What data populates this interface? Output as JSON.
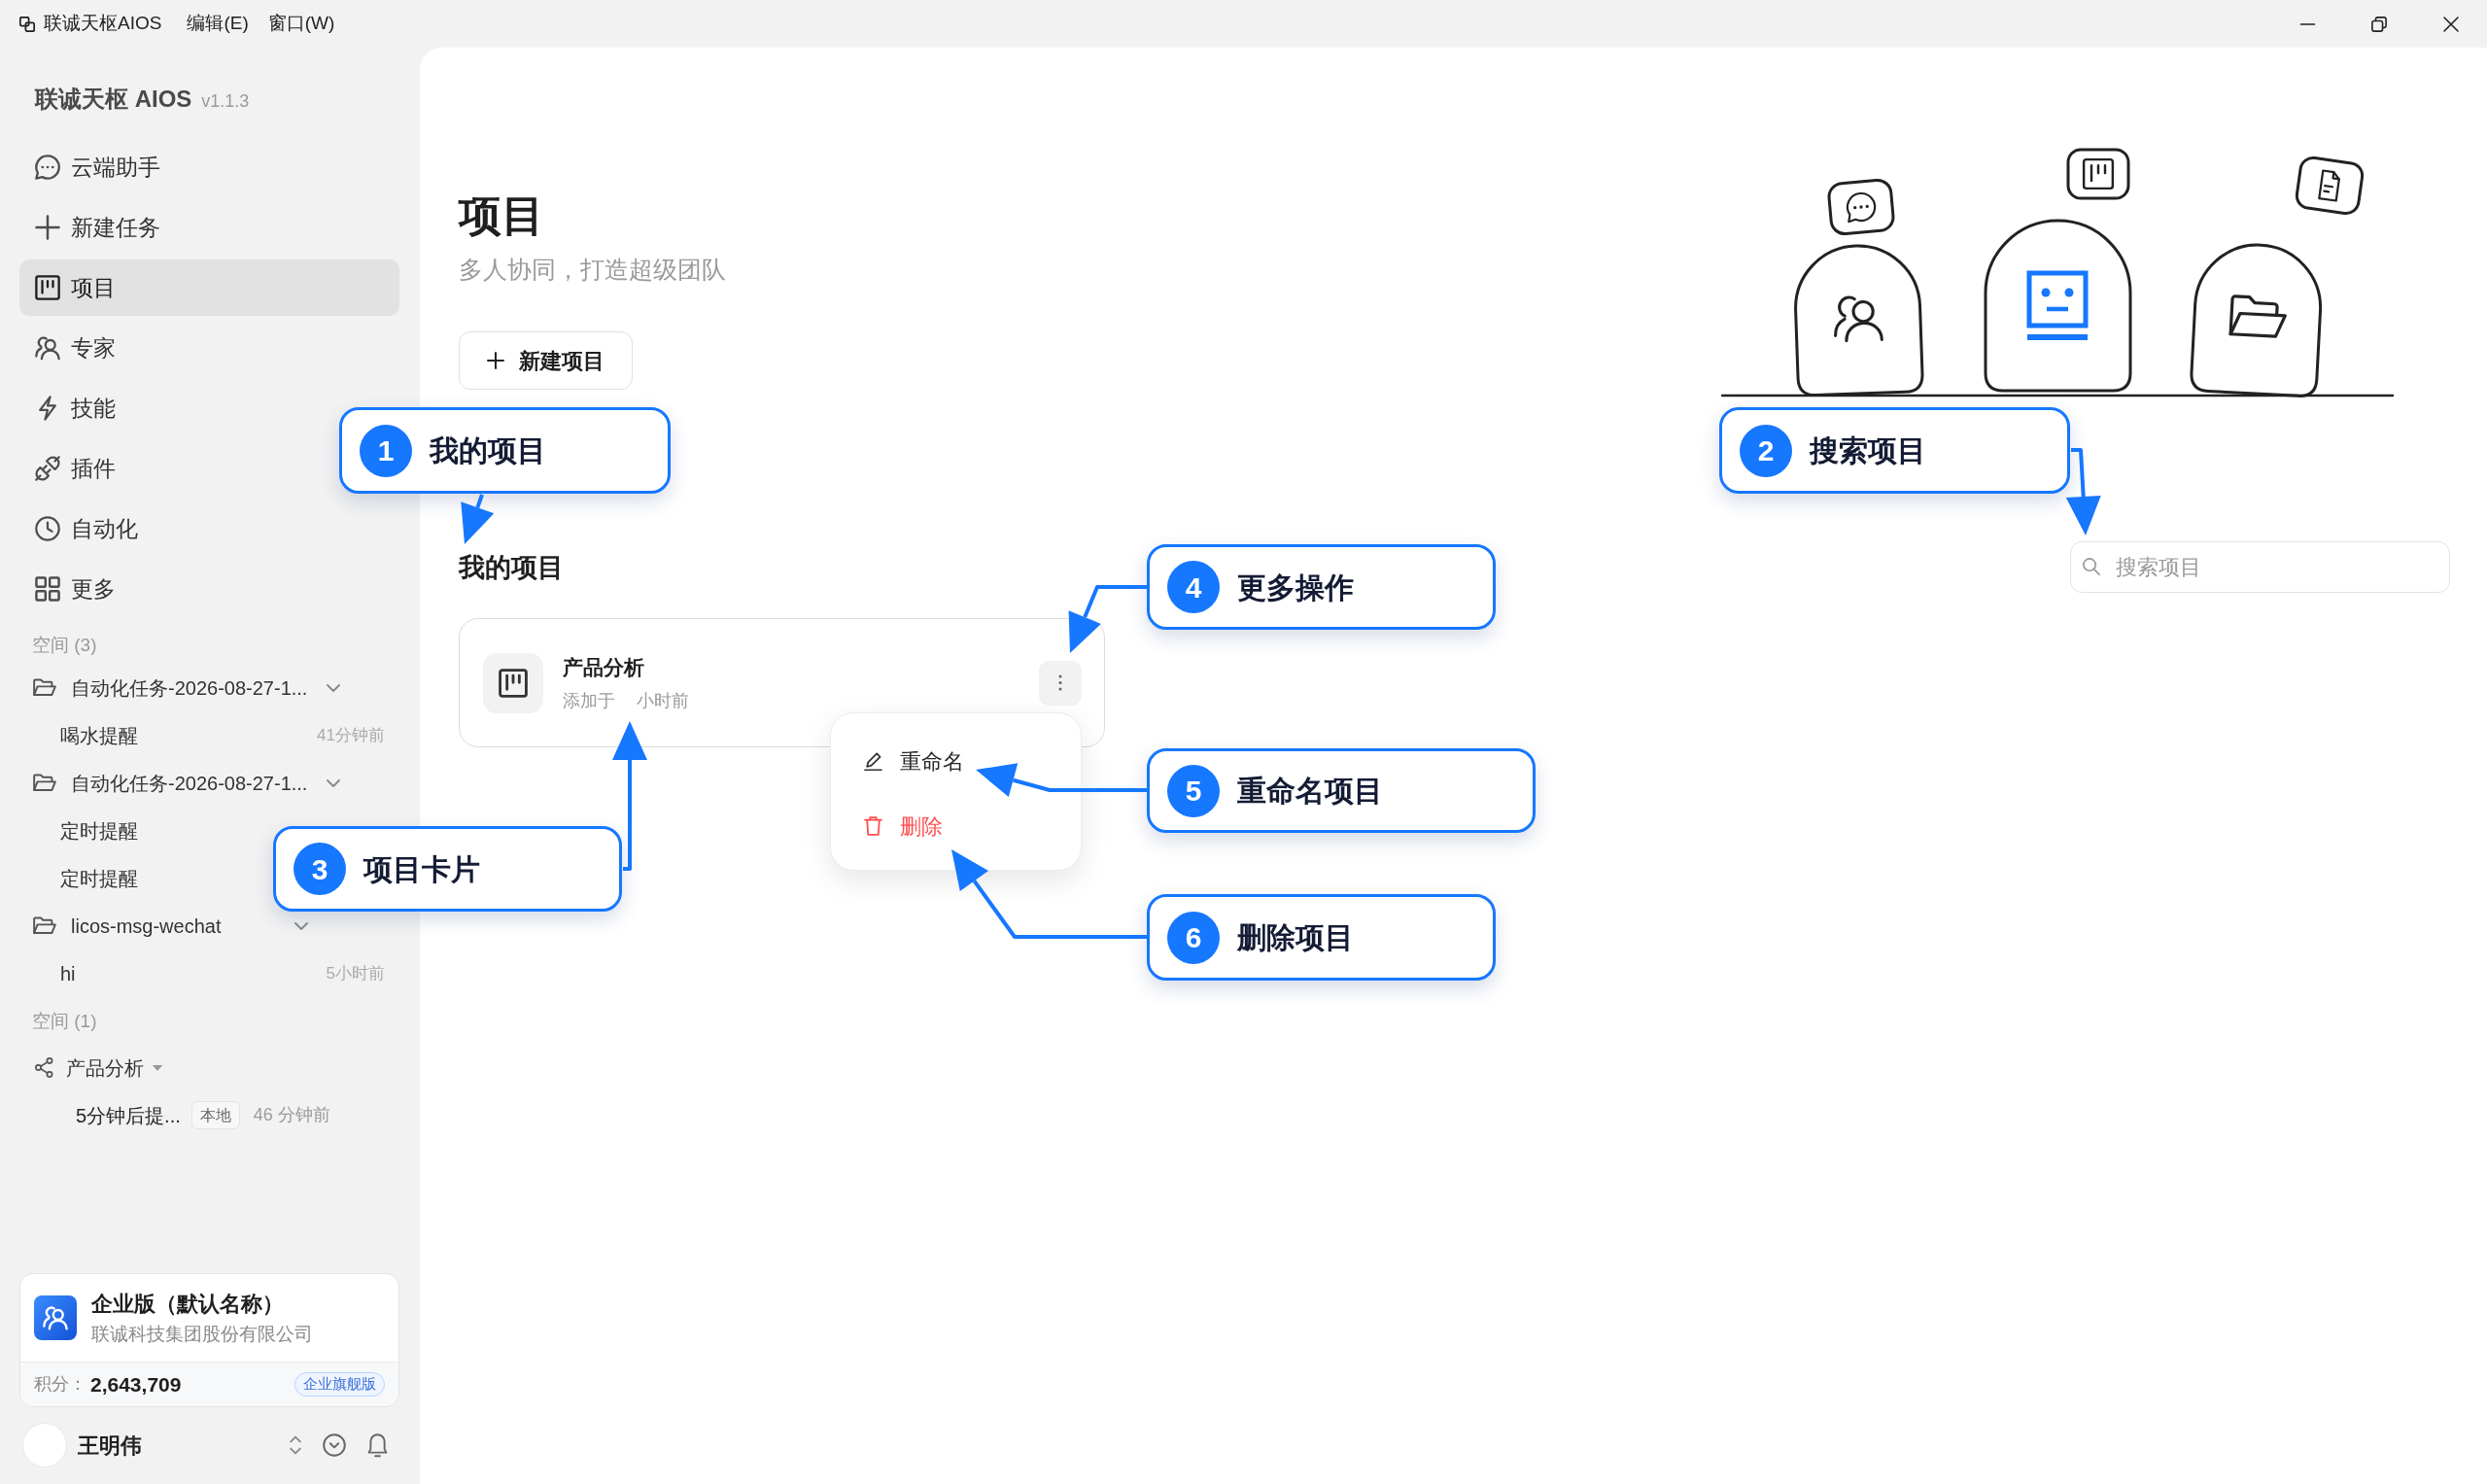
{
  "title_bar": {
    "app_name": "联诚天枢AIOS",
    "menus": [
      "编辑(E)",
      "窗口(W)"
    ]
  },
  "sidebar": {
    "brand": "联诚天枢 AIOS",
    "version": "v1.1.3",
    "nav": [
      {
        "label": "云端助手",
        "selected": false
      },
      {
        "label": "新建任务",
        "selected": false
      },
      {
        "label": "项目",
        "selected": true
      },
      {
        "label": "专家",
        "selected": false
      },
      {
        "label": "技能",
        "selected": false
      },
      {
        "label": "插件",
        "selected": false
      },
      {
        "label": "自动化",
        "selected": false
      },
      {
        "label": "更多",
        "selected": false
      }
    ],
    "spaces": [
      {
        "title": "空间 (3)",
        "items": [
          {
            "kind": "folder",
            "name": "自动化任务-2026-08-27-1...",
            "expanded": true,
            "children": [
              {
                "name": "喝水提醒",
                "time": "41分钟前"
              }
            ]
          },
          {
            "kind": "folder",
            "name": "自动化任务-2026-08-27-1...",
            "expanded": true,
            "children": [
              {
                "name": "定时提醒"
              },
              {
                "name": "定时提醒"
              }
            ]
          },
          {
            "kind": "folder",
            "name": "licos-msg-wechat",
            "expanded": true,
            "children": [
              {
                "name": "hi",
                "time": "5小时前"
              }
            ]
          }
        ]
      },
      {
        "title": "空间 (1)",
        "items": [
          {
            "kind": "shared",
            "name": "产品分析",
            "expanded": true,
            "children": [
              {
                "name": "5分钟后提...",
                "tag": "本地",
                "time": "46 分钟前"
              }
            ]
          }
        ]
      }
    ],
    "plan": {
      "name": "企业版（默认名称）",
      "company": "联诚科技集团股份有限公司",
      "points_label": "积分：",
      "points": "2,643,709",
      "tier": "企业旗舰版"
    },
    "user": {
      "name": "王明伟"
    }
  },
  "main": {
    "title": "项目",
    "subtitle": "多人协同，打造超级团队",
    "new_button": "新建项目",
    "search": {
      "placeholder": "搜索项目"
    },
    "section_title": "我的项目",
    "projects": [
      {
        "name": "产品分析",
        "added": [
          "添加于",
          "小时前"
        ],
        "menu_open": true
      }
    ],
    "context_menu": [
      {
        "kind": "normal",
        "label": "重命名"
      },
      {
        "kind": "danger",
        "label": "删除"
      }
    ]
  },
  "annotations": [
    {
      "number": "1",
      "label": "我的项目"
    },
    {
      "number": "2",
      "label": "搜索项目"
    },
    {
      "number": "3",
      "label": "项目卡片"
    },
    {
      "number": "4",
      "label": "更多操作"
    },
    {
      "number": "5",
      "label": "重命名项目"
    },
    {
      "number": "6",
      "label": "删除项目"
    }
  ]
}
